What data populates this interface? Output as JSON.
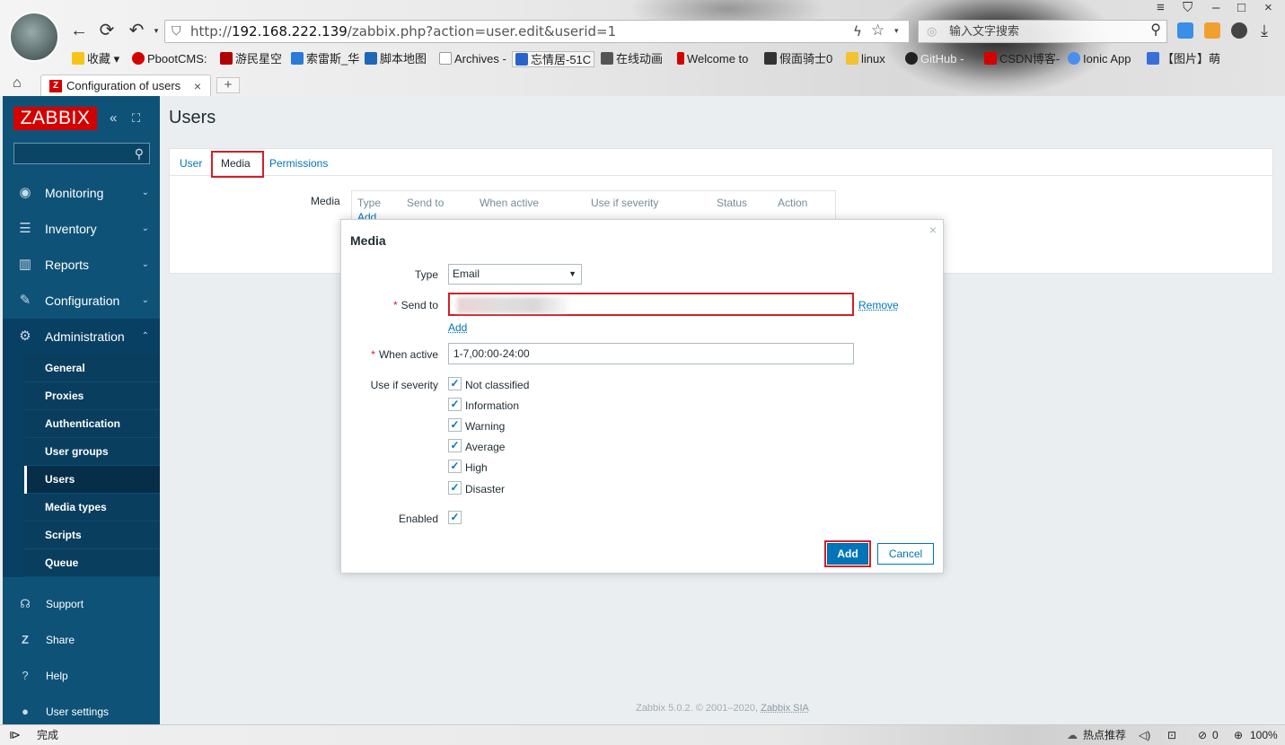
{
  "browser": {
    "url_prefix": "http://",
    "url_host": "192.168.222.139",
    "url_path": "/zabbix.php?action=user.edit&userid=1",
    "search_placeholder": "输入文字搜索",
    "bookmarks": [
      "收藏",
      "PbootCMS:",
      "游民星空",
      "索雷斯_华",
      "脚本地图",
      "Archives -",
      "忘情居-51C",
      "在线动画",
      "Welcome to",
      "假面骑士0",
      "linux",
      "GitHub -",
      "CSDN博客-",
      "Ionic App",
      "【图片】萌"
    ],
    "tab_title": "Configuration of users",
    "tab_favicon": "Z",
    "status_text": "完成",
    "status_hot": "热点推荐",
    "status_count": "0",
    "zoom": "100%"
  },
  "sidebar": {
    "logo": "ZABBIX",
    "menu": [
      "Monitoring",
      "Inventory",
      "Reports",
      "Configuration",
      "Administration"
    ],
    "submenu": [
      "General",
      "Proxies",
      "Authentication",
      "User groups",
      "Users",
      "Media types",
      "Scripts",
      "Queue"
    ],
    "lower": [
      "Support",
      "Share",
      "Help",
      "User settings"
    ]
  },
  "page": {
    "title": "Users",
    "tabs": [
      "User",
      "Media",
      "Permissions"
    ],
    "media_label": "Media",
    "media_columns": [
      "Type",
      "Send to",
      "When active",
      "Use if severity",
      "Status",
      "Action"
    ],
    "media_add": "Add",
    "footer": "Zabbix 5.0.2. © 2001–2020,",
    "footer_link": "Zabbix SIA"
  },
  "dialog": {
    "title": "Media",
    "close": "×",
    "type_label": "Type",
    "type_value": "Email",
    "send_to_label": "Send to",
    "remove": "Remove",
    "add_link": "Add",
    "when_active_label": "When active",
    "when_active_value": "1-7,00:00-24:00",
    "severity_label": "Use if severity",
    "severities": [
      "Not classified",
      "Information",
      "Warning",
      "Average",
      "High",
      "Disaster"
    ],
    "enabled_label": "Enabled",
    "add_button": "Add",
    "cancel_button": "Cancel"
  },
  "colors": {
    "zabbix_red": "#d40000",
    "sidebar": "#0e5277",
    "link": "#0275b8",
    "highlight": "#d21f27"
  }
}
